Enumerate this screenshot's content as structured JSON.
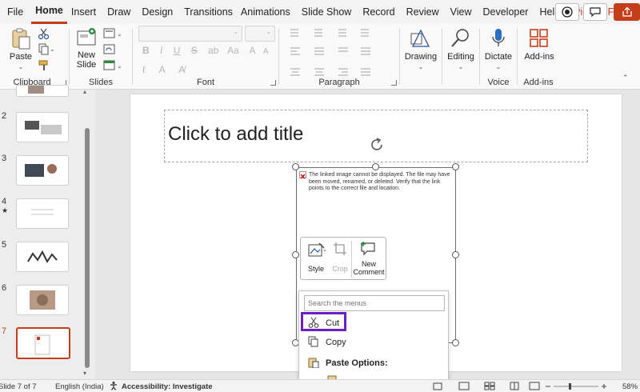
{
  "tabs": [
    "File",
    "Home",
    "Insert",
    "Draw",
    "Design",
    "Transitions",
    "Animations",
    "Slide Show",
    "Record",
    "Review",
    "View",
    "Developer",
    "Help",
    "Picture Format"
  ],
  "ribbon": {
    "clipboard": {
      "label": "Clipboard",
      "paste": "Paste"
    },
    "slides": {
      "label": "Slides",
      "new_slide_line1": "New",
      "new_slide_line2": "Slide"
    },
    "font": {
      "label": "Font"
    },
    "paragraph": {
      "label": "Paragraph"
    },
    "drawing": {
      "label": "Drawing"
    },
    "editing": {
      "label": "Editing"
    },
    "voice": {
      "label": "Voice",
      "dictate": "Dictate"
    },
    "addins": {
      "label": "Add-ins",
      "button": "Add-ins"
    }
  },
  "thumbnails": {
    "numbers": [
      "2",
      "3",
      "4",
      "5",
      "6",
      "7"
    ],
    "star": "★"
  },
  "slide": {
    "title_placeholder": "Click to add title",
    "broken_image_text": "The linked image cannot be displayed.  The file may have been moved, renamed, or deleted. Verify that the link points to the correct file and location."
  },
  "mini_toolbar": {
    "style": "Style",
    "crop": "Crop",
    "new_comment_line1": "New",
    "new_comment_line2": "Comment"
  },
  "context_menu": {
    "search_placeholder": "Search the menus",
    "cut": "Cut",
    "copy": "Copy",
    "paste_options": "Paste Options:"
  },
  "status": {
    "slide_count": "Slide 7 of 7",
    "language": "English (India)",
    "accessibility": "Accessibility: Investigate",
    "zoom": "58%"
  },
  "colors": {
    "accent": "#c43e1c",
    "highlight": "#6b21c6"
  }
}
